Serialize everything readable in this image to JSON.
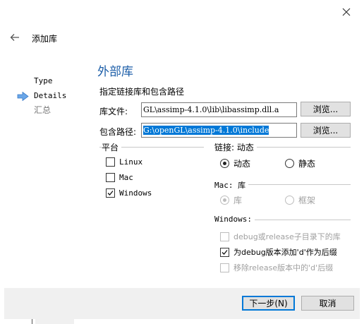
{
  "window": {
    "title": "添加库"
  },
  "steps": [
    {
      "label": "Type",
      "current": false
    },
    {
      "label": "Details",
      "current": true
    },
    {
      "label": "汇总",
      "current": false
    }
  ],
  "page": {
    "heading": "外部库",
    "subheading": "指定链接库和包含路径"
  },
  "library_file": {
    "label": "库文件:",
    "value": "GL\\assimp-4.1.0\\lib\\libassimp.dll.a",
    "browse_label": "浏览..."
  },
  "include_path": {
    "label": "包含路径:",
    "value": "G:\\openGL\\assimp-4.1.0\\include",
    "browse_label": "浏览..."
  },
  "platform": {
    "title": "平台",
    "items": [
      {
        "label": "Linux",
        "checked": false
      },
      {
        "label": "Mac",
        "checked": false
      },
      {
        "label": "Windows",
        "checked": true
      }
    ]
  },
  "linking": {
    "title": "链接: 动态",
    "options": [
      {
        "label": "动态",
        "selected": true
      },
      {
        "label": "静态",
        "selected": false
      }
    ]
  },
  "mac": {
    "title": "Mac: 库",
    "options": [
      {
        "label": "库",
        "selected": true
      },
      {
        "label": "框架",
        "selected": false
      }
    ]
  },
  "windows": {
    "title": "Windows:",
    "options": [
      {
        "label": "debug或release子目录下的库",
        "checked": false,
        "enabled": false
      },
      {
        "label": "为debug版本添加'd'作为后缀",
        "checked": true,
        "enabled": true
      },
      {
        "label": "移除release版本中的'd'后缀",
        "checked": false,
        "enabled": false
      }
    ]
  },
  "footer": {
    "next_label": "下一步(N)",
    "cancel_label": "取消"
  }
}
